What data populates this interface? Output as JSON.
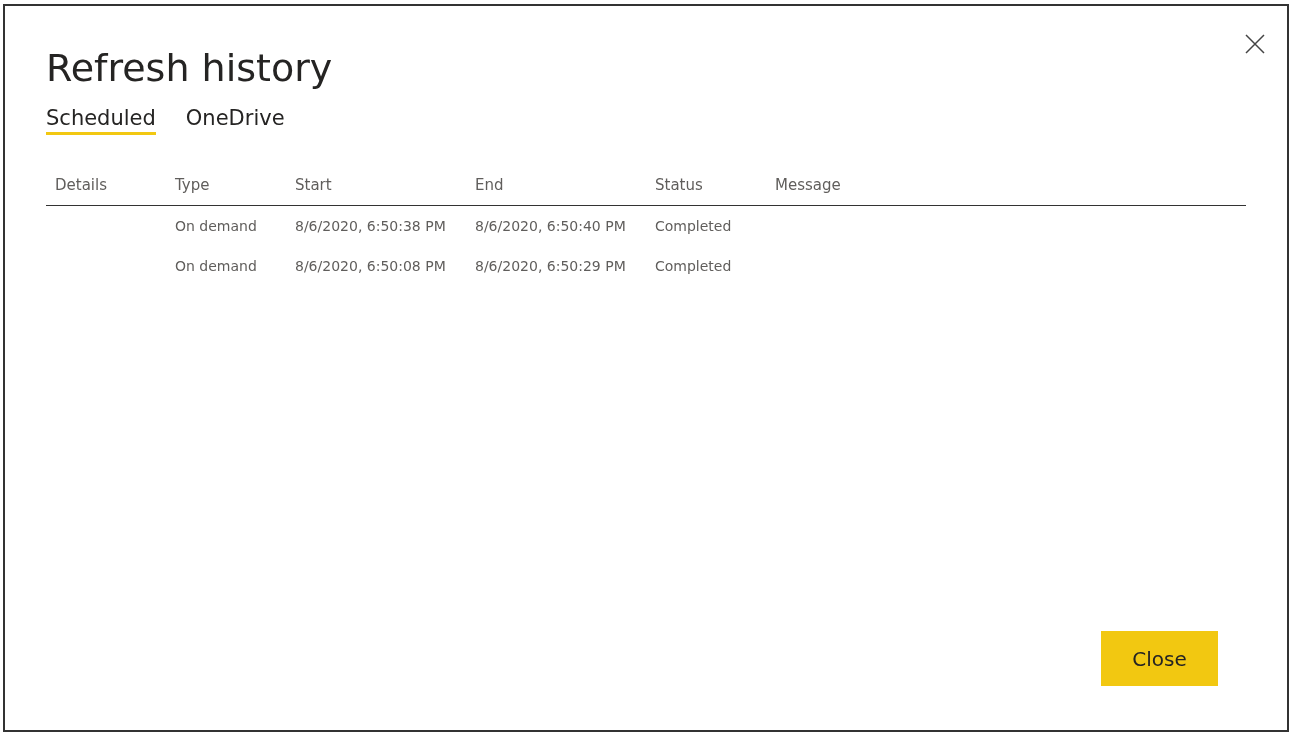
{
  "dialog": {
    "title": "Refresh history"
  },
  "tabs": [
    {
      "label": "Scheduled",
      "selected": true
    },
    {
      "label": "OneDrive",
      "selected": false
    }
  ],
  "table": {
    "columns": [
      "Details",
      "Type",
      "Start",
      "End",
      "Status",
      "Message"
    ],
    "rows": [
      {
        "type": "On demand",
        "start": "8/6/2020, 6:50:38 PM",
        "end": "8/6/2020, 6:50:40 PM",
        "status": "Completed"
      },
      {
        "type": "On demand",
        "start": "8/6/2020, 6:50:08 PM",
        "end": "8/6/2020, 6:50:29 PM",
        "status": "Completed"
      }
    ]
  },
  "buttons": [
    "Close"
  ]
}
